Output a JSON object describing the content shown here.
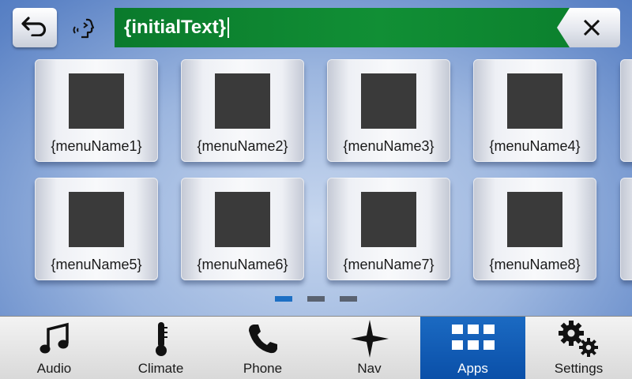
{
  "search": {
    "text": "{initialText}"
  },
  "top_bar": {
    "back_icon": "back-arrow-icon",
    "voice_icon": "voice-command-icon",
    "clear_icon": "close-icon"
  },
  "tiles": [
    {
      "label": "{menuName1}"
    },
    {
      "label": "{menuName2}"
    },
    {
      "label": "{menuName3}"
    },
    {
      "label": "{menuName4}"
    },
    {
      "label": "{menuName5}"
    },
    {
      "label": "{menuName6}"
    },
    {
      "label": "{menuName7}"
    },
    {
      "label": "{menuName8}"
    }
  ],
  "pagination": {
    "pages": 3,
    "current": 1
  },
  "nav": {
    "active": "Apps",
    "items": [
      {
        "label": "Audio",
        "icon": "music-note-icon"
      },
      {
        "label": "Climate",
        "icon": "thermometer-icon"
      },
      {
        "label": "Phone",
        "icon": "phone-icon"
      },
      {
        "label": "Nav",
        "icon": "compass-star-icon"
      },
      {
        "label": "Apps",
        "icon": "apps-grid-icon"
      },
      {
        "label": "Settings",
        "icon": "gears-icon"
      }
    ]
  },
  "colors": {
    "search_field": "#118f35",
    "active_nav": "#0a4fa8",
    "active_page_dot": "#1d6fc4",
    "inactive_page_dot": "#5a6270"
  }
}
